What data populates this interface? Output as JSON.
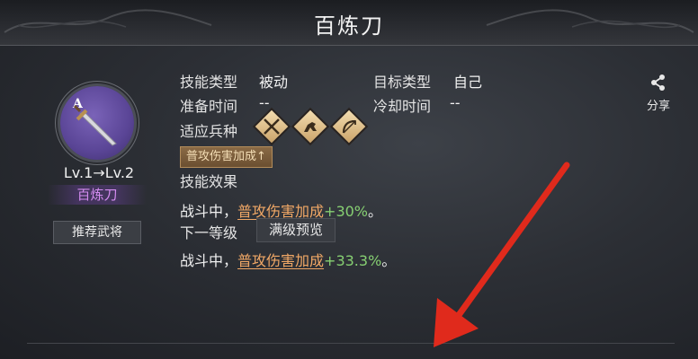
{
  "title": "百炼刀",
  "skill": {
    "level_text": "Lv.1→Lv.2",
    "name": "百炼刀",
    "recommend_label": "推荐武将"
  },
  "info": {
    "skill_type_label": "技能类型",
    "skill_type_value": "被动",
    "target_type_label": "目标类型",
    "target_type_value": "自己",
    "prep_time_label": "准备时间",
    "prep_time_value": "--",
    "cooldown_label": "冷却时间",
    "cooldown_value": "--",
    "troop_label": "适应兵种",
    "troop_icons": [
      "infantry-icon",
      "cavalry-icon",
      "archer-icon"
    ]
  },
  "tag": "普攻伤害加成↑",
  "effect_label": "技能效果",
  "effect_current": {
    "prefix": "战斗中，",
    "link": "普攻伤害加成",
    "plus": "+30%",
    "suffix": "。"
  },
  "next_level_label": "下一等级",
  "max_preview_label": "满级预览",
  "effect_next": {
    "prefix": "战斗中，",
    "link": "普攻伤害加成",
    "plus": "+33.3%",
    "suffix": "。"
  },
  "share_label": "分享",
  "colors": {
    "accent_link": "#f1a866",
    "positive_value": "#86cf72",
    "skill_name": "#d48cf0",
    "annotation_arrow": "#e02a1c"
  }
}
